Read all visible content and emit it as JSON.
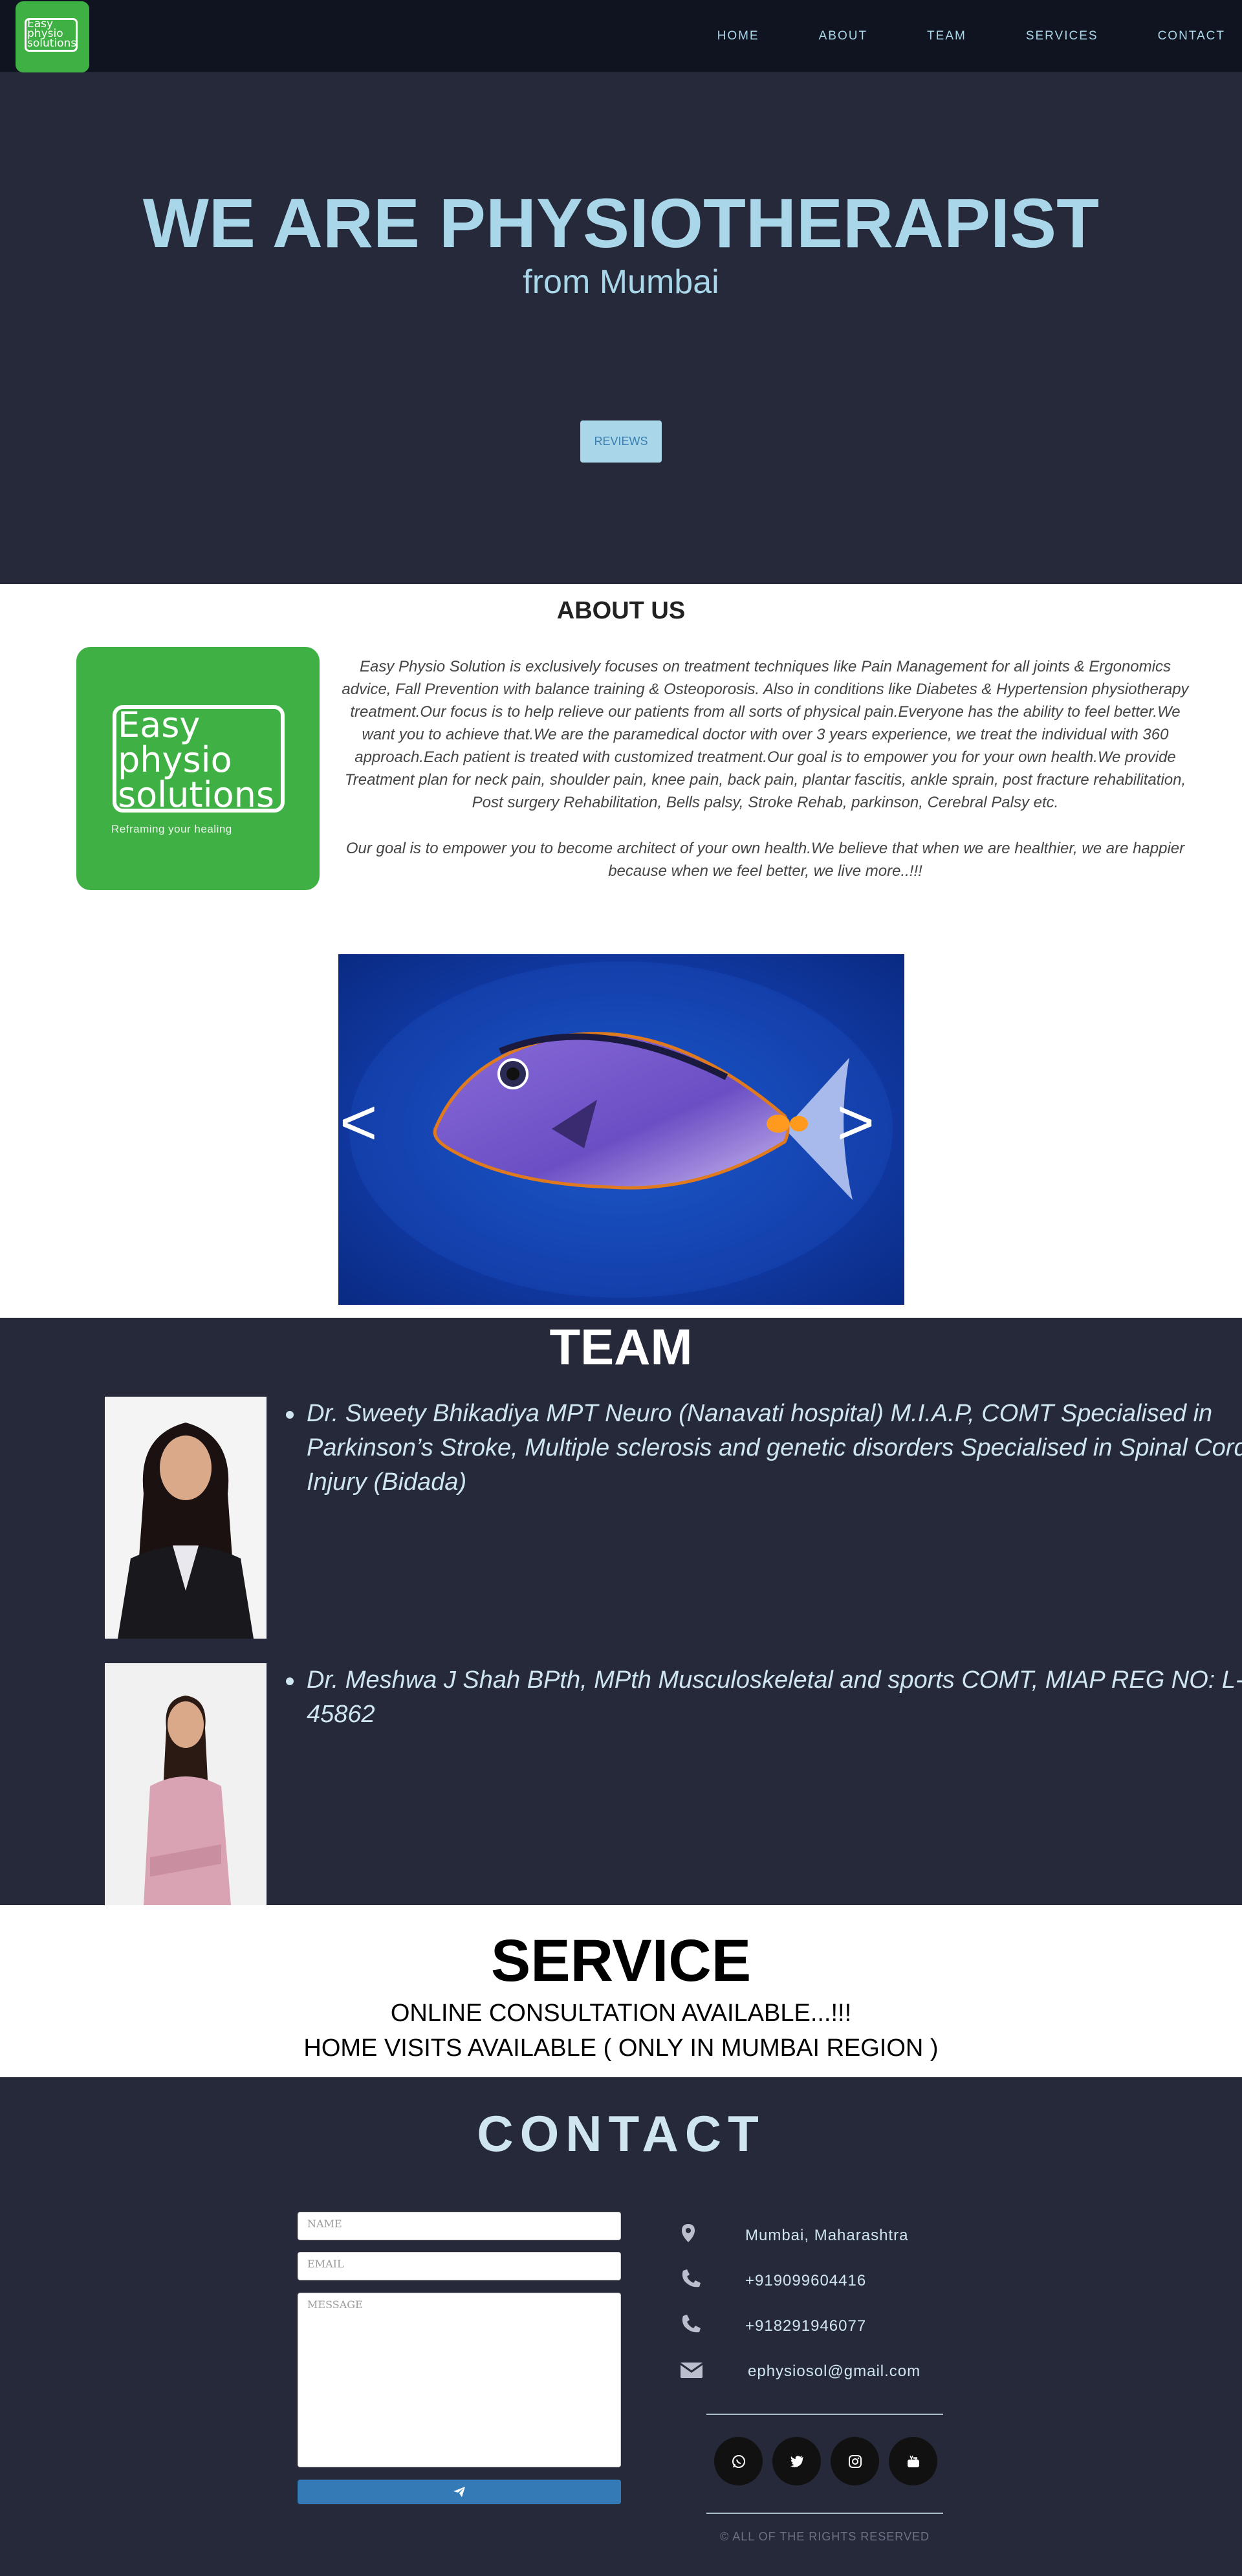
{
  "nav": {
    "logo_text": [
      "Easy",
      "physio",
      "solutions"
    ],
    "items": [
      "HOME",
      "ABOUT",
      "TEAM",
      "SERVICES",
      "CONTACT"
    ]
  },
  "hero": {
    "title": "WE ARE PHYSIOTHERAPIST",
    "subtitle": "from Mumbai",
    "reviews_label": "REVIEWS"
  },
  "about": {
    "title": "ABOUT US",
    "logo_line1": "Easy",
    "logo_line2": "physio",
    "logo_line3": "solutions",
    "logo_tagline": "Reframing your healing",
    "paragraph1": "Easy Physio Solution is exclusively focuses on treatment techniques like Pain Management for all joints & Ergonomics advice, Fall Prevention with balance training & Osteoporosis. Also in conditions like Diabetes & Hypertension physiotherapy treatment.Our focus is to help relieve our patients from all sorts of physical pain.Everyone has the ability to feel better.We want you to achieve that.We are the paramedical doctor with over 3 years experience, we treat the individual with 360 approach.Each patient is treated with customized treatment.Our goal is to empower you for your own health.We provide Treatment plan for neck pain, shoulder pain, knee pain, back pain, plantar fascitis, ankle sprain, post fracture rehabilitation, Post surgery Rehabilitation, Bells palsy, Stroke Rehab, parkinson, Cerebral Palsy etc.",
    "paragraph2": "Our goal is to empower you to become architect of your own health.We believe that when we are healthier, we are happier because when we feel better, we live more..!!!",
    "carousel_prev": "<",
    "carousel_next": ">"
  },
  "team": {
    "title": "TEAM",
    "members": [
      {
        "text": "Dr. Sweety Bhikadiya MPT Neuro (Nanavati hospital) M.I.A.P, COMT Specialised in Parkinson’s Stroke, Multiple sclerosis and genetic disorders Specialised in Spinal Cord Injury (Bidada)"
      },
      {
        "text": "Dr. Meshwa J Shah BPth, MPth Musculoskeletal and sports COMT, MIAP REG NO: L-45862"
      }
    ]
  },
  "service": {
    "title": "SERVICE",
    "line1": "ONLINE CONSULTATION AVAILABLE...!!!",
    "line2": "HOME VISITS AVAILABLE ( ONLY IN MUMBAI REGION )"
  },
  "contact": {
    "title": "CONTACT",
    "name_placeholder": "NAME",
    "email_placeholder": "EMAIL",
    "message_placeholder": "MESSAGE",
    "location": "Mumbai, Maharashtra",
    "phone1": "+919099604416",
    "phone2": "+918291946077",
    "email": "ephysiosol@gmail.com",
    "social_icons": [
      "whatsapp-icon",
      "twitter-icon",
      "instagram-icon",
      "youtube-icon"
    ],
    "copyright": "© ALL OF THE RIGHTS RESERVED"
  },
  "colors": {
    "dark_bg": "#252939",
    "nav_bg": "#0f1420",
    "accent_light_blue": "#a9d6e8",
    "brand_green": "#3fb144",
    "button_blue": "#337ab7"
  }
}
